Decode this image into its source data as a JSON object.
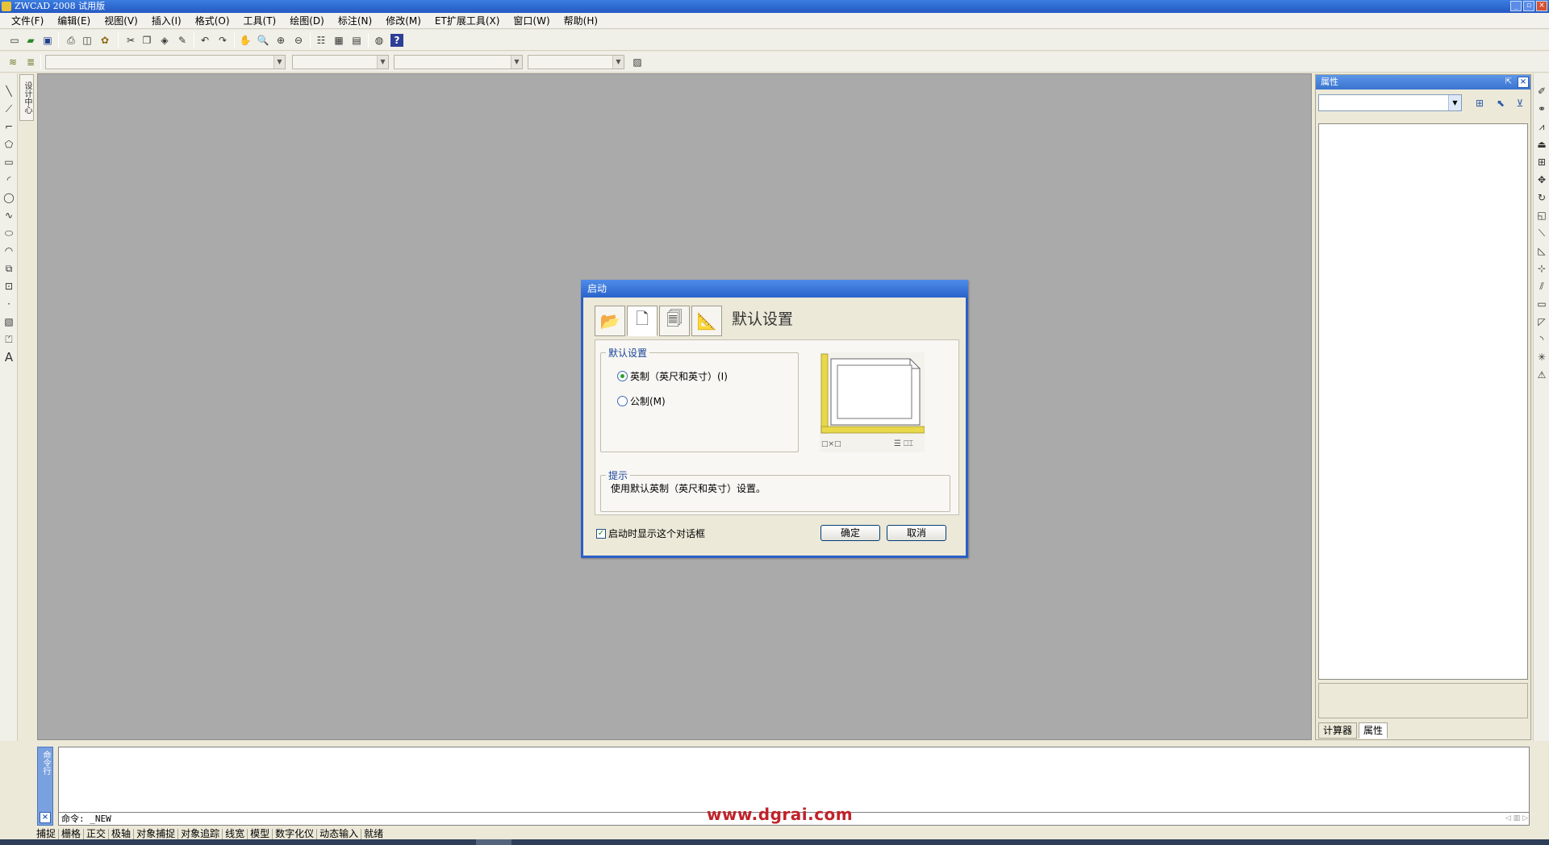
{
  "window": {
    "title": "ZWCAD 2008 试用版",
    "min": "_",
    "restore": "▫",
    "close": "×"
  },
  "menu": [
    "文件(F)",
    "编辑(E)",
    "视图(V)",
    "插入(I)",
    "格式(O)",
    "工具(T)",
    "绘图(D)",
    "标注(N)",
    "修改(M)",
    "ET扩展工具(X)",
    "窗口(W)",
    "帮助(H)"
  ],
  "left_dock_tab": "设计中心",
  "properties_panel": {
    "title": "属性",
    "pin_glyph": "⇱",
    "close_glyph": "×",
    "tabs": [
      "计算器",
      "属性"
    ],
    "active_tab": "属性"
  },
  "command_window": {
    "side_label": "命令行",
    "close_glyph": "×",
    "current_line": "命令: _NEW"
  },
  "watermark": "www.dgrai.com",
  "status_bar": [
    "捕捉",
    "栅格",
    "正交",
    "极轴",
    "对象捕捉",
    "对象追踪",
    "线宽",
    "模型",
    "数字化仪",
    "动态输入",
    "就绪"
  ],
  "dialog": {
    "title": "启动",
    "heading": "默认设置",
    "tabs": [
      {
        "name": "open-drawing",
        "glyph": "📂"
      },
      {
        "name": "start-from-scratch",
        "glyph": "🗋"
      },
      {
        "name": "use-template",
        "glyph": "🗐"
      },
      {
        "name": "use-wizard",
        "glyph": "📐"
      }
    ],
    "group_label": "默认设置",
    "options": [
      {
        "label": "英制（英尺和英寸）(I)",
        "selected": true
      },
      {
        "label": "公制(M)",
        "selected": false
      }
    ],
    "hint_label": "提示",
    "hint_text": "使用默认英制（英尺和英寸）设置。",
    "show_on_startup_label": "启动时显示这个对话框",
    "show_on_startup_checked": true,
    "ok": "确定",
    "cancel": "取消"
  },
  "icons": {
    "toolbar1": [
      "new-icon",
      "open-icon",
      "save-icon",
      "print-icon",
      "print-preview-icon",
      "publish-icon",
      "cut-icon",
      "copy-icon",
      "paste-icon",
      "match-properties-icon",
      "undo-icon",
      "redo-icon",
      "pan-icon",
      "zoom-realtime-icon",
      "zoom-window-icon",
      "zoom-previous-icon",
      "properties-icon",
      "design-center-icon",
      "tool-palette-icon",
      "calculator-icon",
      "help-icon"
    ],
    "left": [
      "line-icon",
      "construction-line-icon",
      "polyline-icon",
      "polygon-icon",
      "rectangle-icon",
      "arc-icon",
      "circle-icon",
      "spline-icon",
      "ellipse-icon",
      "ellipse-arc-icon",
      "insert-block-icon",
      "make-block-icon",
      "point-icon",
      "hatch-icon",
      "region-icon",
      "text-icon"
    ],
    "right": [
      "erase-icon",
      "copy-object-icon",
      "mirror-icon",
      "offset-icon",
      "array-icon",
      "move-icon",
      "rotate-icon",
      "scale-icon",
      "stretch-icon",
      "lengthen-icon",
      "trim-icon",
      "extend-icon",
      "break-icon",
      "chamfer-icon",
      "fillet-icon",
      "explode-icon",
      "flatten-icon"
    ]
  },
  "colors": {
    "title_bar": "#2a62cb",
    "canvas": "#aaaaaa",
    "watermark": "#c0222a"
  }
}
